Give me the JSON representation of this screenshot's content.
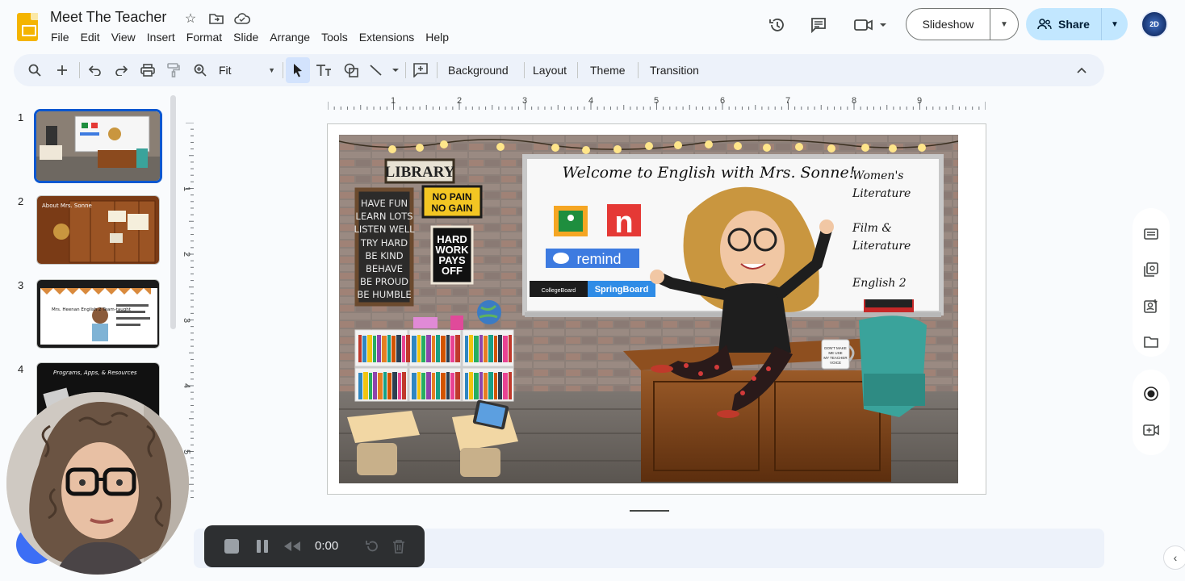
{
  "app": {
    "doc_title": "Meet The Teacher",
    "menu": [
      "File",
      "Edit",
      "View",
      "Insert",
      "Format",
      "Slide",
      "Arrange",
      "Tools",
      "Extensions",
      "Help"
    ],
    "slideshow_label": "Slideshow",
    "share_label": "Share",
    "avatar_text": "2D"
  },
  "toolbar": {
    "zoom_label": "Fit",
    "background_label": "Background",
    "layout_label": "Layout",
    "theme_label": "Theme",
    "transition_label": "Transition"
  },
  "filmstrip": {
    "slides": [
      {
        "num": "1",
        "title": "",
        "selected": true
      },
      {
        "num": "2",
        "title": "About Mrs. Sonne",
        "selected": false
      },
      {
        "num": "3",
        "title": "Mrs. Heenan English 2 Team-taught",
        "selected": false
      },
      {
        "num": "4",
        "title": "Programs, Apps, & Resources",
        "selected": false
      }
    ]
  },
  "ruler": {
    "h_labels": [
      "1",
      "2",
      "3",
      "4",
      "5",
      "6",
      "7",
      "8",
      "9"
    ],
    "v_labels": [
      "1",
      "2",
      "3",
      "4",
      "5"
    ]
  },
  "slide": {
    "welcome": "Welcome to English with Mrs. Sonne!",
    "courses": [
      "Women's Literature",
      "Film & Literature",
      "English 2"
    ],
    "library_sign": "LIBRARY",
    "no_pain": "NO PAIN NO GAIN",
    "hard_work": "HARD WORK PAYS OFF",
    "chalk_lines": [
      "HAVE FUN",
      "LEARN LOTS",
      "LISTEN WELL",
      "TRY HARD",
      "BE KIND",
      "BEHAVE",
      "BE PROUD",
      "BE HUMBLE"
    ],
    "remind_label": "remind",
    "collegeboard_label": "CollegeBoard",
    "springboard_label": "SpringBoard",
    "mug_text": "DON'T MAKE ME USE MY TEACHER VOICE"
  },
  "recorder": {
    "time": "0:00"
  },
  "colors": {
    "accent": "#0b57d0",
    "share_bg": "#c2e7ff",
    "toolbar_bg": "#edf2fa",
    "slides_yellow": "#f4b400"
  }
}
